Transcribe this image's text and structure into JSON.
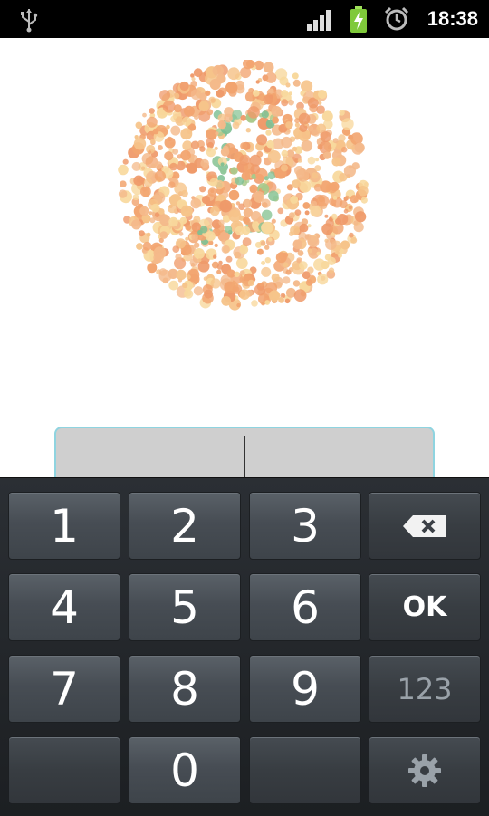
{
  "status_bar": {
    "time": "18:38",
    "icons": [
      "usb-icon",
      "signal-icon",
      "battery-charging-icon",
      "alarm-icon"
    ]
  },
  "plate": {
    "description_icon": "ishihara-color-plate",
    "colors": {
      "background_dots": [
        "#f6c48a",
        "#f2a46f",
        "#f8d89c",
        "#ef9a6a",
        "#f4b98a"
      ],
      "figure_dots": [
        "#8fc79a",
        "#a9c98b",
        "#7dbf92"
      ]
    }
  },
  "answer": {
    "left_value": "",
    "right_value": ""
  },
  "keypad": {
    "keys": [
      {
        "label": "1"
      },
      {
        "label": "2"
      },
      {
        "label": "3"
      },
      {
        "label": "",
        "icon": "backspace-icon"
      },
      {
        "label": "4"
      },
      {
        "label": "5"
      },
      {
        "label": "6"
      },
      {
        "label": "OK"
      },
      {
        "label": "7"
      },
      {
        "label": "8"
      },
      {
        "label": "9"
      },
      {
        "label": "123"
      },
      {
        "label": ""
      },
      {
        "label": "0"
      },
      {
        "label": ""
      },
      {
        "label": "",
        "icon": "settings-gear-icon"
      }
    ]
  }
}
